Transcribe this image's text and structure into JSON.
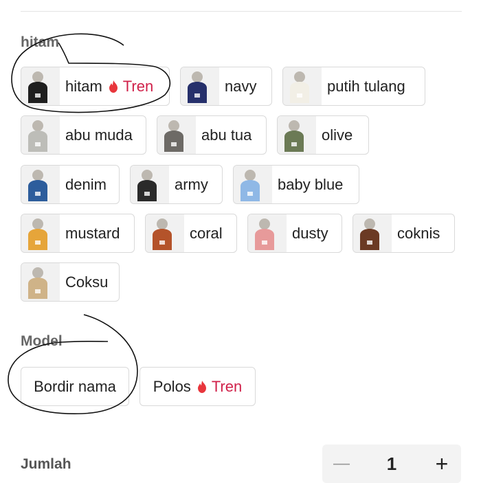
{
  "sections": {
    "color": {
      "label": "hitam",
      "options": [
        {
          "label": "hitam",
          "tren": "Tren",
          "hat_color": "#1f1f1f"
        },
        {
          "label": "navy",
          "hat_color": "#26306b"
        },
        {
          "label": "putih tulang",
          "hat_color": "#f2efe6"
        },
        {
          "label": "abu muda",
          "hat_color": "#bdbdb8"
        },
        {
          "label": "abu tua",
          "hat_color": "#6d6a66"
        },
        {
          "label": "olive",
          "hat_color": "#6b7a55"
        },
        {
          "label": "denim",
          "hat_color": "#2d5d9c"
        },
        {
          "label": "army",
          "hat_color": "#2a2a2a"
        },
        {
          "label": "baby blue",
          "hat_color": "#8fb8e6"
        },
        {
          "label": "mustard",
          "hat_color": "#e6a53a"
        },
        {
          "label": "coral",
          "hat_color": "#b4532a"
        },
        {
          "label": "dusty",
          "hat_color": "#e79a9a"
        },
        {
          "label": "coknis",
          "hat_color": "#6b3a24"
        },
        {
          "label": "Coksu",
          "hat_color": "#cfb388"
        }
      ]
    },
    "model": {
      "label": "Model",
      "options": [
        {
          "label": "Bordir nama"
        },
        {
          "label": "Polos",
          "tren": "Tren"
        }
      ]
    }
  },
  "quantity": {
    "label": "Jumlah",
    "minus": "—",
    "value": "1",
    "plus": "+"
  },
  "colors": {
    "tren_red": "#d0214a",
    "border": "#d9d9d9",
    "label_gray": "#666666"
  }
}
